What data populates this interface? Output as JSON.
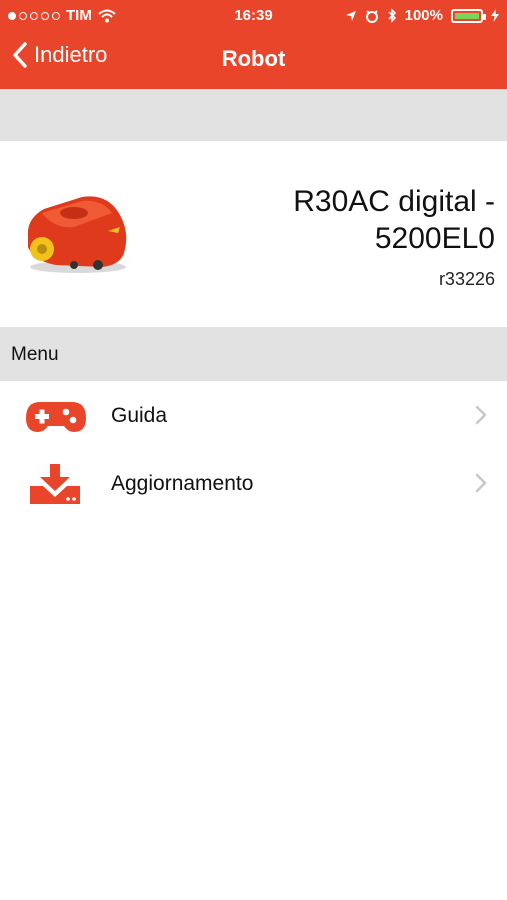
{
  "status_bar": {
    "carrier": "TIM",
    "time": "16:39",
    "battery": "100%",
    "signal_strength": 1
  },
  "nav": {
    "back_label": "Indietro",
    "title": "Robot"
  },
  "robot": {
    "name": "R30AC digital - 5200EL0",
    "serial": "r33226"
  },
  "menu": {
    "header": "Menu",
    "items": [
      {
        "label": "Guida",
        "icon": "gamepad-icon"
      },
      {
        "label": "Aggiornamento",
        "icon": "download-icon"
      }
    ]
  },
  "colors": {
    "accent": "#e8452b",
    "section_bg": "#e2e2e2",
    "battery_fill": "#7bd35a"
  }
}
